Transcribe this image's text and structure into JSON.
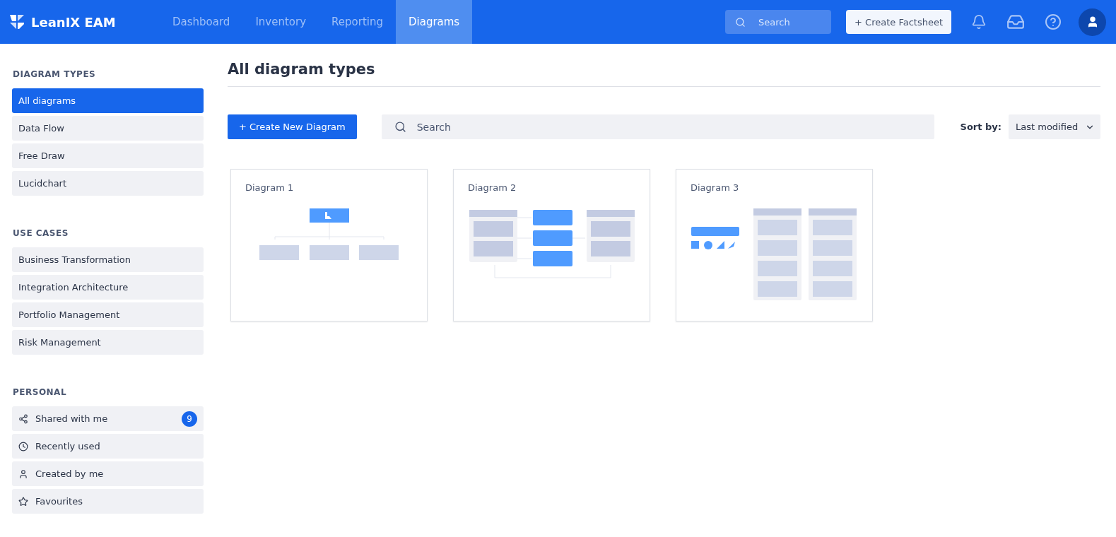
{
  "brand": {
    "name": "LeanIX EAM"
  },
  "nav": [
    {
      "label": "Dashboard",
      "selected": false
    },
    {
      "label": "Inventory",
      "selected": false
    },
    {
      "label": "Reporting",
      "selected": false
    },
    {
      "label": "Diagrams",
      "selected": true
    }
  ],
  "header_search": {
    "placeholder": "Search"
  },
  "create_factsheet": "+ Create Factsheet",
  "sidebar": [
    {
      "title": "DIAGRAM TYPES",
      "items": [
        {
          "label": "All diagrams",
          "selected": true
        },
        {
          "label": "Data Flow",
          "selected": false
        },
        {
          "label": "Free Draw",
          "selected": false
        },
        {
          "label": "Lucidchart",
          "selected": false
        }
      ]
    },
    {
      "title": "USE CASES",
      "items": [
        {
          "label": "Business Transformation",
          "selected": false
        },
        {
          "label": "Integration Architecture",
          "selected": false
        },
        {
          "label": "Portfolio Management",
          "selected": false
        },
        {
          "label": "Risk Management",
          "selected": false
        }
      ]
    },
    {
      "title": "PERSONAL",
      "items": [
        {
          "label": "Shared with me",
          "selected": false,
          "kind": "share",
          "badge": "9"
        },
        {
          "label": "Recently used",
          "selected": false,
          "kind": "clock"
        },
        {
          "label": "Created by me",
          "selected": false,
          "kind": "user"
        },
        {
          "label": "Favourites",
          "selected": false,
          "kind": "star"
        }
      ]
    }
  ],
  "page_title": "All diagram types",
  "create_button": "+ Create New Diagram",
  "search": {
    "placeholder": "Search"
  },
  "sort": {
    "label": "Sort by:",
    "value": "Last modified"
  },
  "cards": [
    {
      "title": "Diagram 1",
      "kind": "tree"
    },
    {
      "title": "Diagram 2",
      "kind": "flow"
    },
    {
      "title": "Diagram 3",
      "kind": "board"
    }
  ]
}
